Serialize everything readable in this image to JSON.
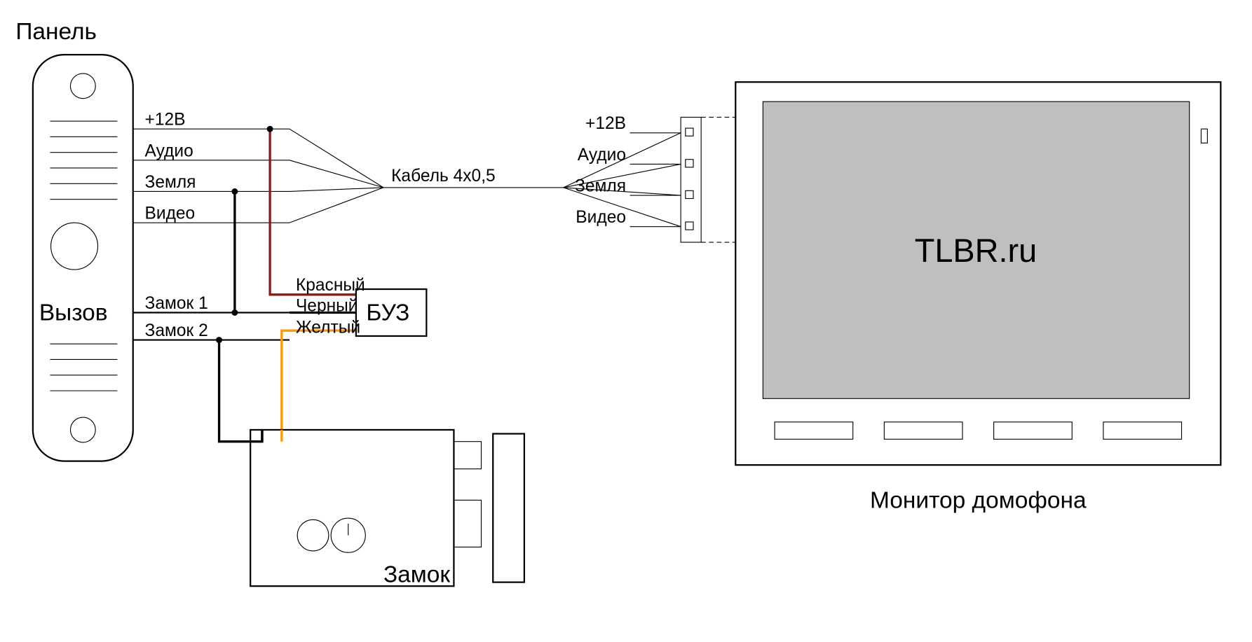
{
  "panel": {
    "title": "Панель",
    "call": "Вызов",
    "wires": {
      "p12v": "+12В",
      "audio": "Аудио",
      "ground": "Земля",
      "video": "Видео",
      "lock1": "Замок 1",
      "lock2": "Замок 2"
    }
  },
  "cable": "Кабель 4x0,5",
  "buz": {
    "label": "БУЗ",
    "red": "Красный",
    "black": "Черный",
    "yellow": "Желтый"
  },
  "lock": {
    "label": "Замок"
  },
  "monitor": {
    "title": "Монитор домофона",
    "screen_text": "TLBR.ru",
    "terminals": {
      "p12v": "+12В",
      "audio": "Аудио",
      "ground": "Земля",
      "video": "Видео"
    }
  },
  "colors": {
    "red": "#8b1a1a",
    "black": "#000000",
    "yellow": "#ff9900"
  }
}
